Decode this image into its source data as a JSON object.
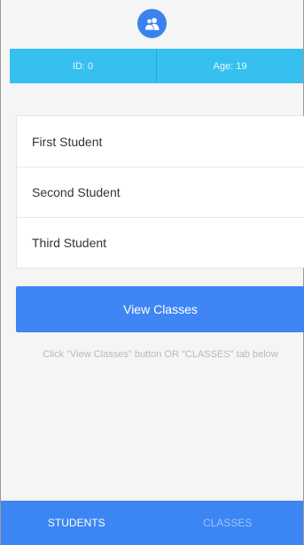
{
  "header": {
    "avatar_icon": "users-icon",
    "id_label": "ID: 0",
    "age_label": "Age: 19"
  },
  "students": [
    {
      "name": "First Student"
    },
    {
      "name": "Second Student"
    },
    {
      "name": "Third Student"
    }
  ],
  "actions": {
    "view_classes_label": "View Classes",
    "hint": "Click \"View Classes\" button OR \"CLASSES\" tab below"
  },
  "tabs": [
    {
      "label": "STUDENTS",
      "active": true
    },
    {
      "label": "CLASSES",
      "active": false
    }
  ],
  "colors": {
    "primary": "#3f86f4",
    "info_bar": "#36c0f0"
  }
}
